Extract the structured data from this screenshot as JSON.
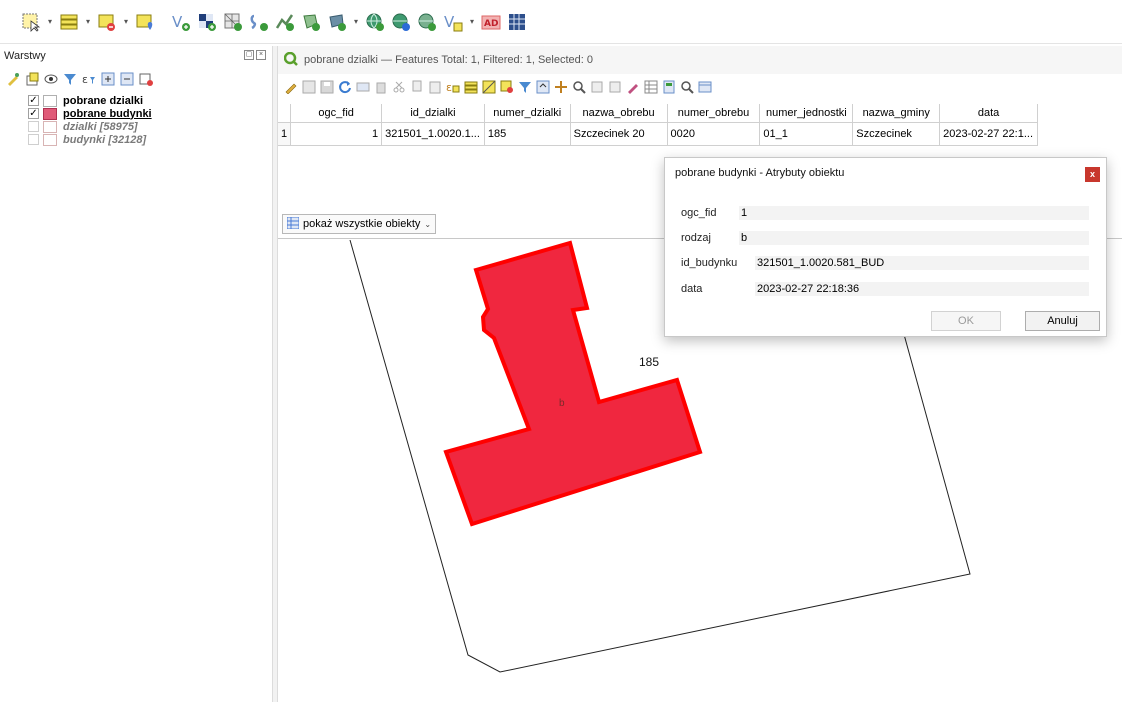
{
  "layers_panel": {
    "title": "Warstwy",
    "layers": [
      {
        "name": "pobrane dzialki",
        "checked": true,
        "symbol_color": "#ffffff"
      },
      {
        "name": "pobrane budynki",
        "checked": true,
        "symbol_color": "#e05a78"
      },
      {
        "name": "dzialki [58975]",
        "checked": false,
        "symbol_color": "#ffffff"
      },
      {
        "name": "budynki [32128]",
        "checked": false,
        "symbol_color": "#ffffff"
      }
    ]
  },
  "attribute_table": {
    "title": "pobrane dzialki — Features Total: 1, Filtered: 1, Selected: 0",
    "columns": [
      "ogc_fid",
      "id_dzialki",
      "numer_dzialki",
      "nazwa_obrebu",
      "numer_obrebu",
      "numer_jednostki",
      "nazwa_gminy",
      "data"
    ],
    "rows": [
      {
        "row_num": "1",
        "cells": [
          "1",
          "321501_1.0020.1...",
          "185",
          "Szczecinek 20",
          "0020",
          "01_1",
          "Szczecinek",
          "2023-02-27 22:1..."
        ]
      }
    ],
    "show_all_label": "pokaż wszystkie obiekty"
  },
  "map": {
    "parcel_label": "185",
    "building_label": "b",
    "building_fill": "#f0273f",
    "building_stroke": "#ff0000"
  },
  "dialog": {
    "title": "pobrane budynki - Atrybuty obiektu",
    "close_label": "x",
    "fields": [
      {
        "label": "ogc_fid",
        "value": "1"
      },
      {
        "label": "rodzaj",
        "value": "b"
      },
      {
        "label": "id_budynku",
        "value": "321501_1.0020.581_BUD"
      },
      {
        "label": "data",
        "value": "2023-02-27 22:18:36"
      }
    ],
    "ok_label": "OK",
    "cancel_label": "Anuluj"
  }
}
